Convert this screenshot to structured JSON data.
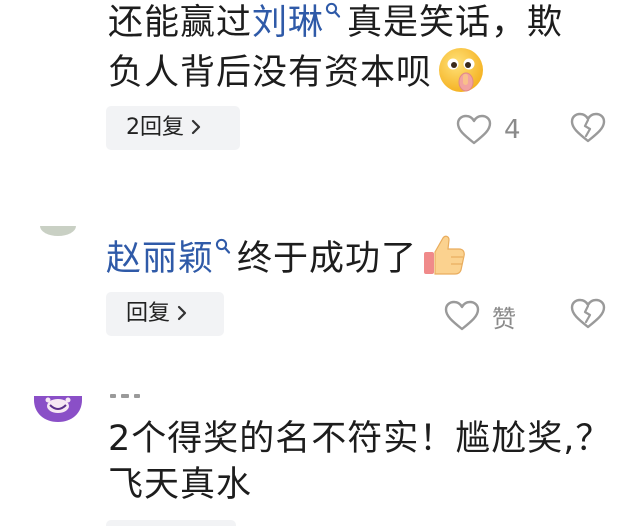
{
  "comments": [
    {
      "line1_prefix": "还能赢过",
      "mention": "刘琳",
      "line1_suffix": "真是笑话，欺",
      "line2": "负人背后没有资本呗",
      "emoji_icon": "shushing-face-emoji",
      "reply_label": "2回复",
      "like_count": "4"
    },
    {
      "mention": "赵丽颖",
      "text": "终于成功了",
      "emoji_icon": "thumbs-up-emoji",
      "reply_label": "回复",
      "like_label": "赞"
    },
    {
      "line1": "2个得奖的名不符实！尴尬奖,？",
      "line2": "飞天真水"
    }
  ],
  "colors": {
    "mention": "#2f5aa8",
    "text": "#1d1d1d",
    "muted": "#8a8a8a",
    "pill_bg": "#f2f3f5",
    "avatar_purple": "#8a4fc7"
  },
  "icons": [
    "search-icon",
    "chevron-right-icon",
    "heart-outline-icon",
    "broken-heart-icon"
  ]
}
